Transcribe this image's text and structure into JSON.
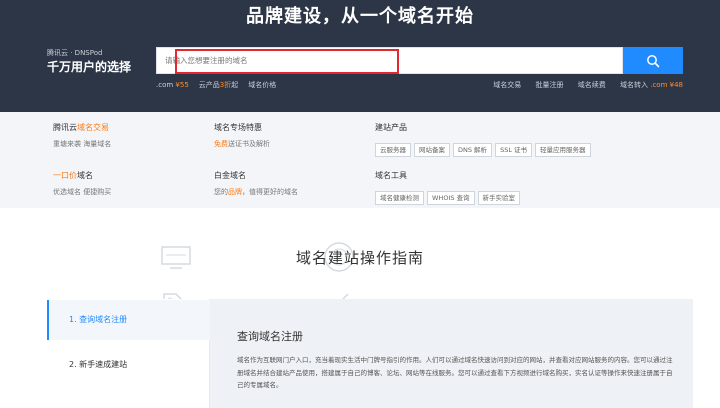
{
  "hero": {
    "title": "品牌建设，从一个域名开始",
    "brand_small": "腾讯云 · DNSPod",
    "brand_big": "千万用户的选择",
    "search_placeholder": "请输入您想要注册的域名",
    "promo_left": {
      "com_prefix": ".com",
      "com_price": "¥55",
      "cloud_prefix": "云产品",
      "cloud_discount": "3折",
      "cloud_suffix": "起",
      "price_link": "域名价格"
    },
    "promo_right": {
      "item1": "域名交易",
      "item2": "批量注册",
      "item3": "域名续费",
      "transfer_prefix": "域名转入",
      "transfer_price": ".com ¥48"
    }
  },
  "grid": {
    "c1": {
      "title_prefix": "腾讯云",
      "title_hl": "域名交易",
      "sub": "重塘来袭 海量域名"
    },
    "c2": {
      "title": "域名专场特惠",
      "sub_hl": "免费",
      "sub_rest": "送证书及解析"
    },
    "c3": {
      "title": "建站产品",
      "tags": [
        "云服务器",
        "网站备案",
        "DNS 解析",
        "SSL 证书",
        "轻量应用服务器"
      ]
    },
    "c4": {
      "title_hl": "一口价",
      "title_rest": "域名",
      "sub": "优选域名 便捷购买"
    },
    "c5": {
      "title": "白金域名",
      "sub_prefix": "您的",
      "sub_hl": "品牌",
      "sub_rest": "，值得更好的域名"
    },
    "c6": {
      "title": "域名工具",
      "tags": [
        "域名健康检测",
        "WHOIS 查询",
        "新手实验室"
      ]
    }
  },
  "guide": {
    "section_title": "域名建站操作指南",
    "side_items": [
      "1. 查询域名注册",
      "2. 新手速成建站"
    ],
    "panel_title": "查询域名注册",
    "panel_text": "域名作为互联网门户入口，充当着现实生活中门牌号指引的作用。人们可以通过域名快速访问到对应的网站，并查看对应网站服务的内容。您可以通过注册域名并结合建站产品使用，搭建属于自己的博客、论坛、网站等在线服务。您可以通过查看下方视频进行域名购买，实名认证等操作来快速注册属于自己的专属域名。"
  },
  "colors": {
    "hero_bg": "#2d3646",
    "accent_blue": "#1f8bff",
    "accent_orange": "#ff7a12",
    "highlight_red": "#e3262f"
  },
  "icons": {
    "search": "search-icon",
    "monitor": "monitor-icon",
    "badge": "badge-icon",
    "globe": "globe-icon",
    "tag": "price-tag-icon",
    "pencil": "pencil-icon",
    "tools": "tools-icon"
  }
}
